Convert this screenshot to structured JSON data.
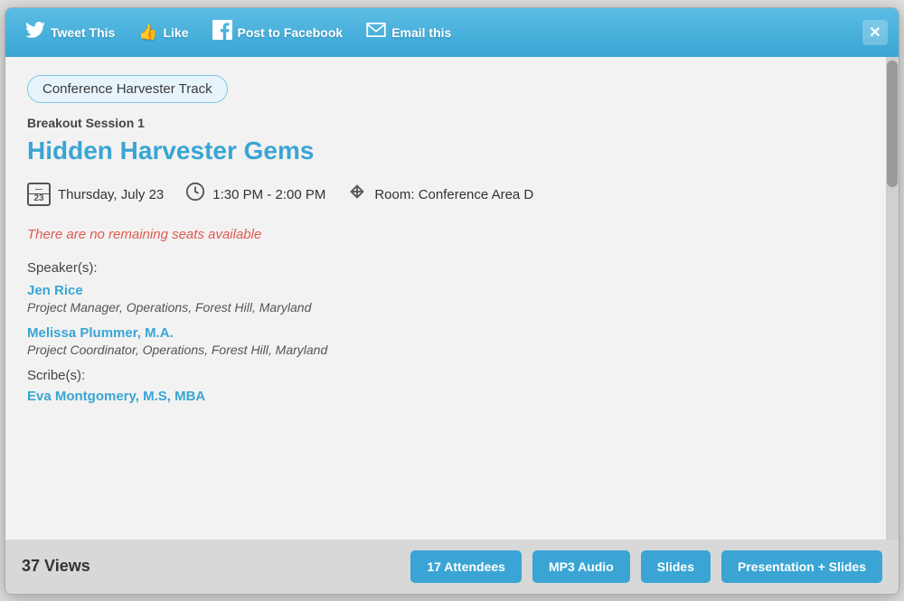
{
  "topbar": {
    "tweet_label": "Tweet This",
    "like_label": "Like",
    "facebook_label": "Post to Facebook",
    "email_label": "Email this",
    "close_label": "✕"
  },
  "track": {
    "badge": "Conference Harvester Track",
    "session_label": "Breakout Session 1",
    "session_title": "Hidden Harvester Gems",
    "date": "Thursday, July 23",
    "time": "1:30 PM - 2:00 PM",
    "room": "Room: Conference Area D",
    "no_seats_msg": "There are no remaining seats available",
    "speakers_label": "Speaker(s):",
    "speakers": [
      {
        "name": "Jen Rice",
        "title": "Project Manager, Operations, Forest Hill, Maryland"
      },
      {
        "name": "Melissa Plummer, M.A.",
        "title": "Project Coordinator, Operations, Forest Hill, Maryland"
      }
    ],
    "scribes_label": "Scribe(s):",
    "scribes": [
      {
        "name": "Eva Montgomery, M.S, MBA"
      }
    ]
  },
  "bottombar": {
    "views": "37 Views",
    "btn_attendees": "17 Attendees",
    "btn_mp3": "MP3 Audio",
    "btn_slides": "Slides",
    "btn_presentation": "Presentation + Slides"
  }
}
